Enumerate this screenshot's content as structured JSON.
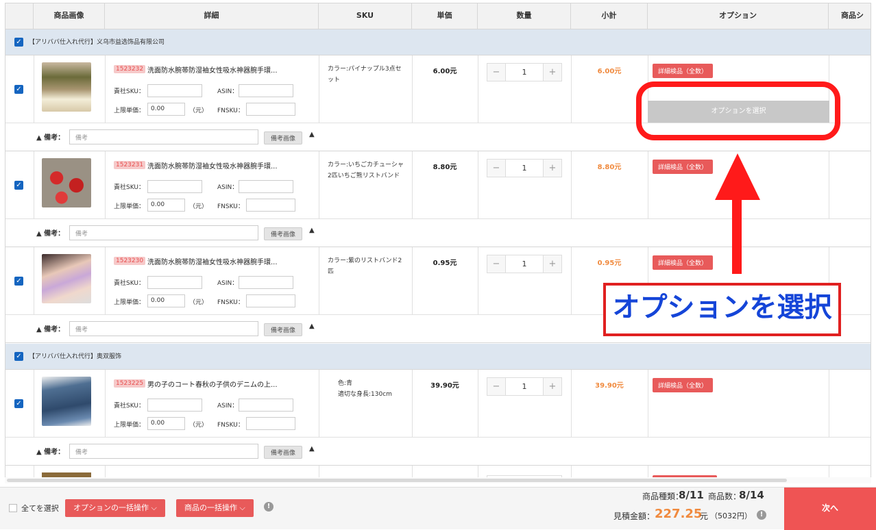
{
  "table": {
    "headers": [
      "",
      "商品画像",
      "詳細",
      "SKU",
      "単価",
      "数量",
      "小計",
      "オプション",
      "商品シ"
    ]
  },
  "labels": {
    "company_sku": "責社SKU：",
    "asin": "ASIN：",
    "max_price": "上限単価：",
    "yuan": "（元）",
    "fnsku": "FNSKU：",
    "note_label": "▲ 備考：",
    "note_placeholder": "備考",
    "note_image_button": "備考画像",
    "note_toggle": "▲",
    "inspection": "詳細検品（全数）",
    "option_select": "オプションを選択",
    "minus": "−",
    "plus": "+",
    "check": "✓"
  },
  "shops": [
    {
      "name": "【アリババ仕入れ代行】义乌市益选饰品有限公司"
    },
    {
      "name": "【アリババ仕入れ代行】奥双服饰"
    }
  ],
  "items": [
    {
      "id": "1523232",
      "title": "洗面防水腕帯防湿袖女性吸水神器腕手環...",
      "sku": "カラー:パイナップル3点セット",
      "price": "6.00元",
      "qty": "1",
      "subtotal": "6.00元",
      "max_price_value": "0.00"
    },
    {
      "id": "1523231",
      "title": "洗面防水腕帯防湿袖女性吸水神器腕手環...",
      "sku": "カラー:いちごカチューシャ2匹いちご熊リストバンド",
      "price": "8.80元",
      "qty": "1",
      "subtotal": "8.80元",
      "max_price_value": "0.00"
    },
    {
      "id": "1523230",
      "title": "洗面防水腕帯防湿袖女性吸水神器腕手環...",
      "sku": "カラー:紫のリストバンド2匹",
      "price": "0.95元",
      "qty": "1",
      "subtotal": "0.95元",
      "max_price_value": "0.00"
    },
    {
      "id": "1523225",
      "title": "男の子のコート春秋の子供のデニムの上...",
      "sku": "色:青\n適切な身長:130cm",
      "price": "39.90元",
      "qty": "1",
      "subtotal": "39.90元",
      "max_price_value": "0.00"
    }
  ],
  "annotation": {
    "callout_text": "オプションを選択",
    "color": "#ff1a1a",
    "text_color": "#1545d8"
  },
  "footer": {
    "select_all": "全てを選択",
    "bulk_option": "オプションの一括操作 ⌵",
    "bulk_product": "商品の一括操作 ⌵",
    "info": "!",
    "kinds_label": "商品種類：",
    "kinds_value": "8/11",
    "count_label": "商品数：",
    "count_value": "8/14",
    "estimate_label": "見積金額：",
    "estimate_value": "227.25",
    "estimate_unit": "元",
    "estimate_jpy": "（5032円）",
    "next": "次へ"
  },
  "colors": {
    "accent_red": "#e85a5a",
    "orange": "#f08a3e",
    "checkbox_blue": "#1565c0"
  }
}
